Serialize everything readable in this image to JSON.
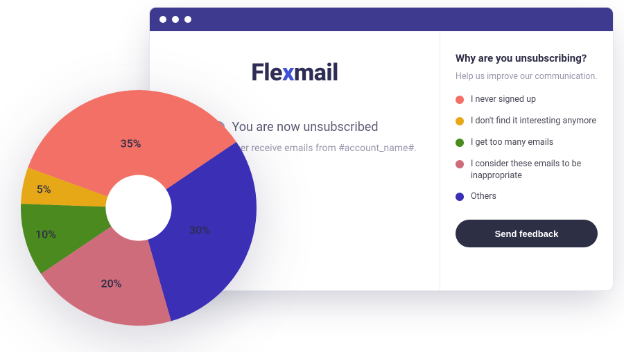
{
  "logo": {
    "pre": "Fle",
    "x": "x",
    "post": "mail"
  },
  "main": {
    "status": "You are now unsubscribed",
    "subtext": "You will no longer receive emails from #account_name#."
  },
  "survey": {
    "title": "Why are you unsubscribing?",
    "subtitle": "Help us improve our communication.",
    "options": [
      {
        "label": "I never signed up",
        "color": "#f37066"
      },
      {
        "label": "I don't find it interesting anymore",
        "color": "#e6a817"
      },
      {
        "label": "I get too many emails",
        "color": "#4a8a1f"
      },
      {
        "label": "I consider these emails to be inappropriate",
        "color": "#cf6c7b"
      },
      {
        "label": "Others",
        "color": "#3a2fb5"
      }
    ],
    "button": "Send feedback"
  },
  "chart_data": {
    "type": "pie",
    "title": "",
    "categories": [
      "I never signed up",
      "Others",
      "I consider these emails to be inappropriate",
      "I get too many emails",
      "I don't find it interesting anymore"
    ],
    "values": [
      35,
      30,
      20,
      10,
      5
    ],
    "series": [
      {
        "name": "I never signed up",
        "value": 35,
        "color": "#f37066"
      },
      {
        "name": "Others",
        "value": 30,
        "color": "#3a2fb5"
      },
      {
        "name": "I consider these emails to be inappropriate",
        "value": 20,
        "color": "#cf6c7b"
      },
      {
        "name": "I get too many emails",
        "value": 10,
        "color": "#4a8a1f"
      },
      {
        "name": "I don't find it interesting anymore",
        "value": 5,
        "color": "#e6a817"
      }
    ],
    "inner_radius_pct": 28,
    "start_angle_deg": 200
  }
}
